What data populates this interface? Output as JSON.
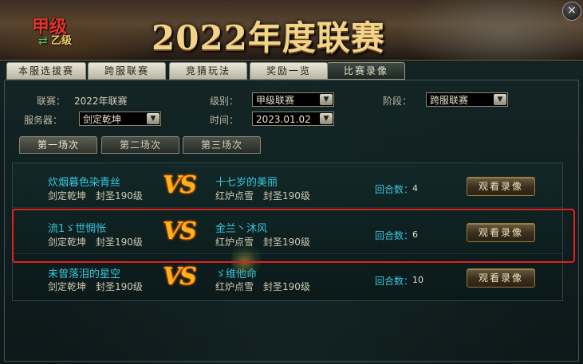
{
  "banner": {
    "title": "2022年度联赛",
    "logo_main": "甲级",
    "logo_sub": "乙级",
    "close_icon": "×"
  },
  "main_tabs": [
    {
      "label": "本服选拔赛",
      "active": false
    },
    {
      "label": "跨服联赛",
      "active": false
    },
    {
      "label": "竞猜玩法",
      "active": false
    },
    {
      "label": "奖励一览",
      "active": false
    },
    {
      "label": "比赛录像",
      "active": true
    }
  ],
  "filters": {
    "league_label": "联赛：",
    "league_value": "2022年联赛",
    "level_label": "级别：",
    "level_value": "甲级联赛",
    "stage_label": "阶段：",
    "stage_value": "跨服联赛",
    "server_label": "服务器：",
    "server_value": "剑定乾坤",
    "time_label": "时间：",
    "time_value": "2023.01.02",
    "dropdown_arrow": "▼"
  },
  "round_tabs": [
    {
      "label": "第一场次",
      "active": true
    },
    {
      "label": "第二场次",
      "active": false
    },
    {
      "label": "第三场次",
      "active": false
    }
  ],
  "matches": [
    {
      "left_name": "炊烟暮色染青丝",
      "left_server": "剑定乾坤",
      "left_level": "封圣190级",
      "right_name": "十七岁的美丽",
      "right_server": "红炉点雪",
      "right_level": "封圣190级",
      "vs": "VS",
      "rounds_label": "回合数：",
      "rounds": "4",
      "watch_label": "观看录像"
    },
    {
      "left_name": "流1ゞ世惆怅",
      "left_server": "剑定乾坤",
      "left_level": "封圣190级",
      "right_name": "金兰丶沐风",
      "right_server": "红炉点雪",
      "right_level": "封圣190级",
      "vs": "VS",
      "rounds_label": "回合数：",
      "rounds": "6",
      "watch_label": "观看录像"
    },
    {
      "left_name": "未曾落泪的星空",
      "left_server": "剑定乾坤",
      "left_level": "封圣190级",
      "right_name": "ゞ维他命",
      "right_server": "红炉点雪",
      "right_level": "封圣190级",
      "vs": "VS",
      "rounds_label": "回合数：",
      "rounds": "10",
      "watch_label": "观看录像"
    }
  ],
  "colors": {
    "accent_cyan": "#35c7de",
    "vs_orange": "#ffb21a",
    "highlight_red": "#e02020",
    "title_gold": "#f1d48a"
  }
}
